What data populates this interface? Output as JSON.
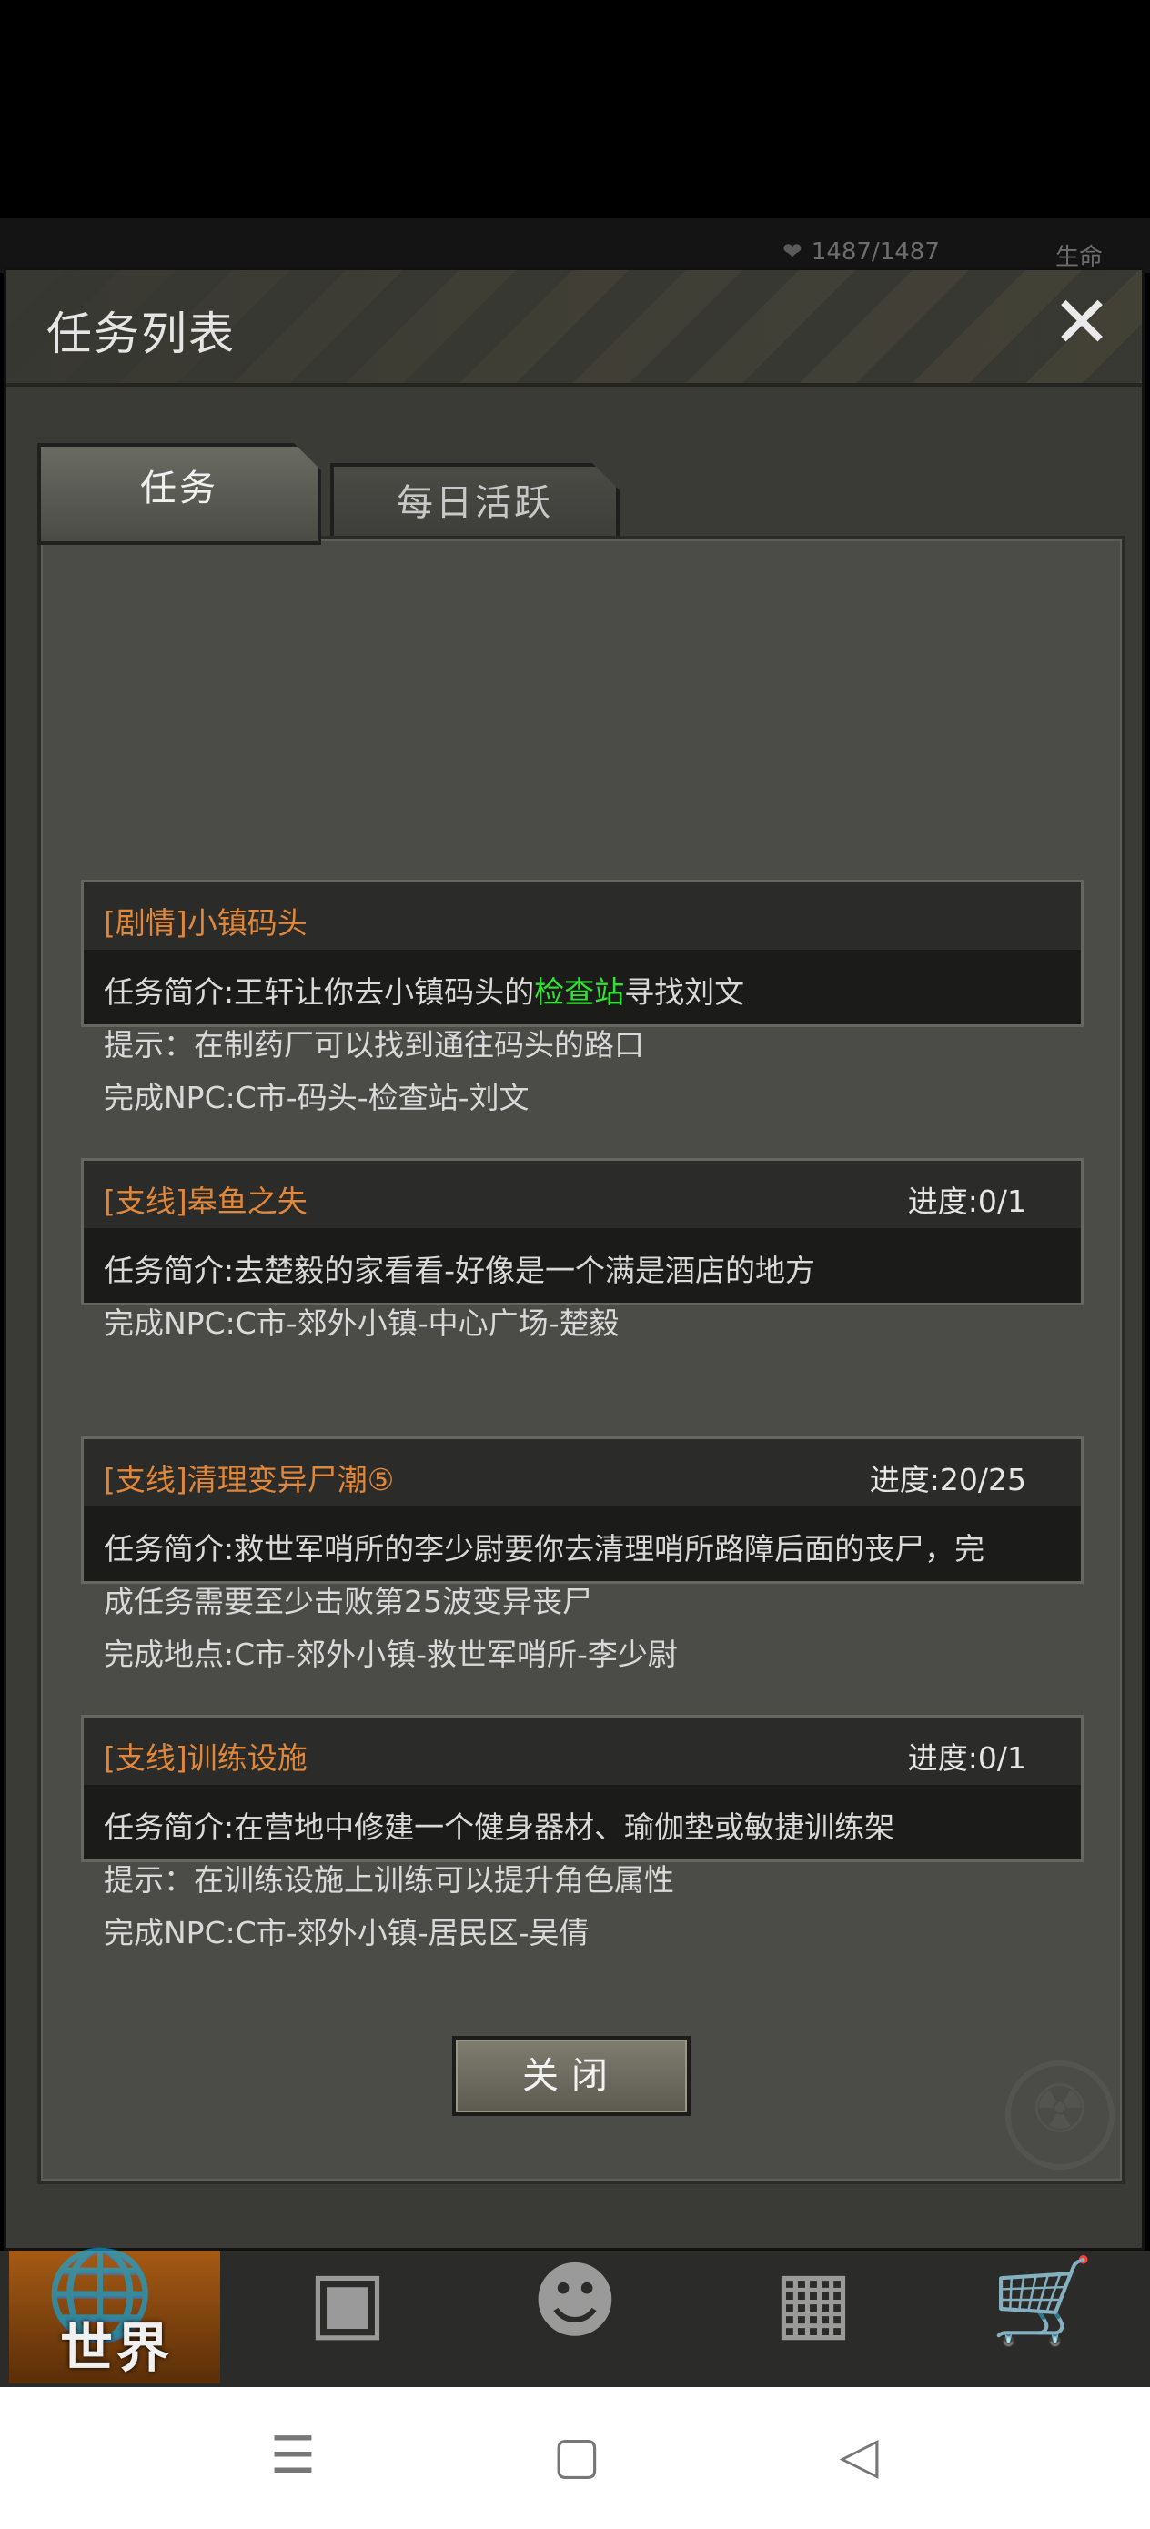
{
  "hud": {
    "hp": "1487/1487",
    "life_label": "生命"
  },
  "dialog": {
    "title": "任务列表",
    "tabs": [
      {
        "label": "任务"
      },
      {
        "label": "每日活跃"
      }
    ],
    "quests": [
      {
        "title": "[剧情]小镇码头",
        "progress": "",
        "lines": [
          {
            "pre": "任务简介:王轩让你去小镇码头的",
            "hl": "检查站",
            "post": "寻找刘文"
          },
          {
            "pre": "提示：在制药厂可以找到通往码头的路口",
            "hl": "",
            "post": ""
          },
          {
            "pre": "完成NPC:C市-码头-检查站-刘文",
            "hl": "",
            "post": ""
          }
        ]
      },
      {
        "title": "[支线]皋鱼之失",
        "progress": "进度:0/1",
        "lines": [
          {
            "pre": "任务简介:去楚毅的家看看-好像是一个满是酒店的地方"
          },
          {
            "pre": "完成NPC:C市-郊外小镇-中心广场-楚毅"
          }
        ]
      },
      {
        "title": "[支线]清理变异尸潮⑤",
        "progress": "进度:20/25",
        "lines": [
          {
            "pre": "任务简介:救世军哨所的李少尉要你去清理哨所路障后面的丧尸，完"
          },
          {
            "pre": "成任务需要至少击败第25波变异丧尸"
          },
          {
            "pre": "完成地点:C市-郊外小镇-救世军哨所-李少尉"
          }
        ]
      },
      {
        "title": "[支线]训练设施",
        "progress": "进度:0/1",
        "lines": [
          {
            "pre": "任务简介:在营地中修建一个健身器材、瑜伽垫或敏捷训练架"
          },
          {
            "pre": "提示：在训练设施上训练可以提升角色属性"
          },
          {
            "pre": "完成NPC:C市-郊外小镇-居民区-吴倩"
          }
        ]
      }
    ],
    "close_button": "关闭"
  },
  "bottom_nav": {
    "world_label": "世界"
  }
}
